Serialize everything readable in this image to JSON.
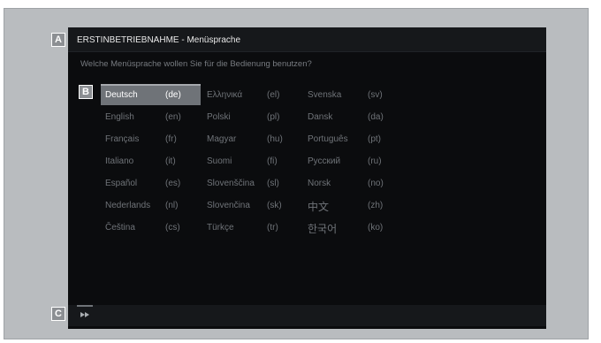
{
  "callouts": {
    "a": "A",
    "b": "B",
    "c": "C"
  },
  "header": {
    "title": "ERSTINBETRIEBNAHME - Menüsprache"
  },
  "question": "Welche Menüsprache wollen Sie für die Bedienung benutzen?",
  "languages": [
    {
      "name": "Deutsch",
      "code": "(de)"
    },
    {
      "name": "English",
      "code": "(en)"
    },
    {
      "name": "Français",
      "code": "(fr)"
    },
    {
      "name": "Italiano",
      "code": "(it)"
    },
    {
      "name": "Español",
      "code": "(es)"
    },
    {
      "name": "Nederlands",
      "code": "(nl)"
    },
    {
      "name": "Čeština",
      "code": "(cs)"
    },
    {
      "name": "Ελληνικά",
      "code": "(el)"
    },
    {
      "name": "Polski",
      "code": "(pl)"
    },
    {
      "name": "Magyar",
      "code": "(hu)"
    },
    {
      "name": "Suomi",
      "code": "(fi)"
    },
    {
      "name": "Slovenščina",
      "code": "(sl)"
    },
    {
      "name": "Slovenčina",
      "code": "(sk)"
    },
    {
      "name": "Türkçe",
      "code": "(tr)"
    },
    {
      "name": "Svenska",
      "code": "(sv)"
    },
    {
      "name": "Dansk",
      "code": "(da)"
    },
    {
      "name": "Português",
      "code": "(pt)"
    },
    {
      "name": "Русский",
      "code": "(ru)"
    },
    {
      "name": "Norsk",
      "code": "(no)"
    },
    {
      "name": "中文",
      "code": "(zh)"
    },
    {
      "name": "한국어",
      "code": "(ko)"
    }
  ],
  "selected_language": "Deutsch",
  "footer": {
    "icon": "fast-forward-icon"
  },
  "colors": {
    "screen": "#0b0c0e",
    "bar": "#16181b",
    "highlight": "#6f7378",
    "text": "#6f7378"
  }
}
